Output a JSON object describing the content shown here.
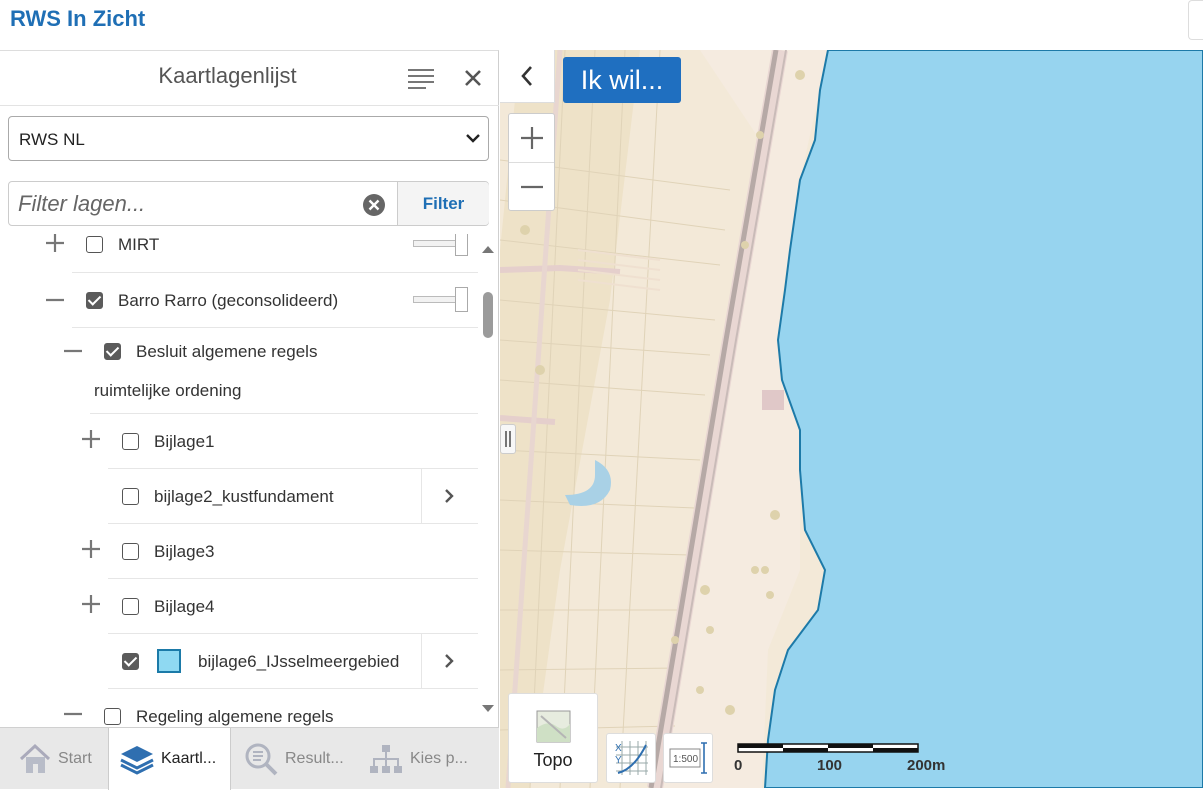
{
  "header": {
    "title": "RWS In Zicht"
  },
  "panel": {
    "title": "Kaartlagenlijst",
    "dropdown_value": "RWS NL",
    "filter": {
      "placeholder": "Filter lagen...",
      "button_label": "Filter"
    },
    "tree": [
      {
        "label": "MIRT",
        "checked": false,
        "expander": "plus"
      },
      {
        "label": "Barro Rarro (geconsolideerd)",
        "checked": true,
        "expander": "minus"
      },
      {
        "label_line1": "Besluit algemene regels",
        "label_line2": "ruimtelijke ordening",
        "checked": true,
        "expander": "minus"
      },
      {
        "label": "Bijlage1",
        "checked": false,
        "expander": "plus"
      },
      {
        "label": "bijlage2_kustfundament",
        "checked": false,
        "expander": "none"
      },
      {
        "label": "Bijlage3",
        "checked": false,
        "expander": "plus"
      },
      {
        "label": "Bijlage4",
        "checked": false,
        "expander": "plus"
      },
      {
        "label": "bijlage6_IJsselmeergebied",
        "checked": true,
        "expander": "none"
      },
      {
        "label": "Regeling algemene regels",
        "checked": false,
        "expander": "minus"
      }
    ],
    "tabs": [
      {
        "label": "Start",
        "icon": "home-icon"
      },
      {
        "label": "Kaartl...",
        "icon": "layers-icon"
      },
      {
        "label": "Result...",
        "icon": "results-icon"
      },
      {
        "label": "Kies p...",
        "icon": "sitemap-icon"
      }
    ]
  },
  "map": {
    "ikwil_label": "Ik wil...",
    "basemap_label": "Topo",
    "scale_tool_label": "1:500",
    "scalebar": {
      "labels": [
        "0",
        "100",
        "200m"
      ]
    },
    "colors": {
      "water": "#97d4ef",
      "land": "#f3e9d8",
      "accent": "#1f6fc0"
    }
  }
}
